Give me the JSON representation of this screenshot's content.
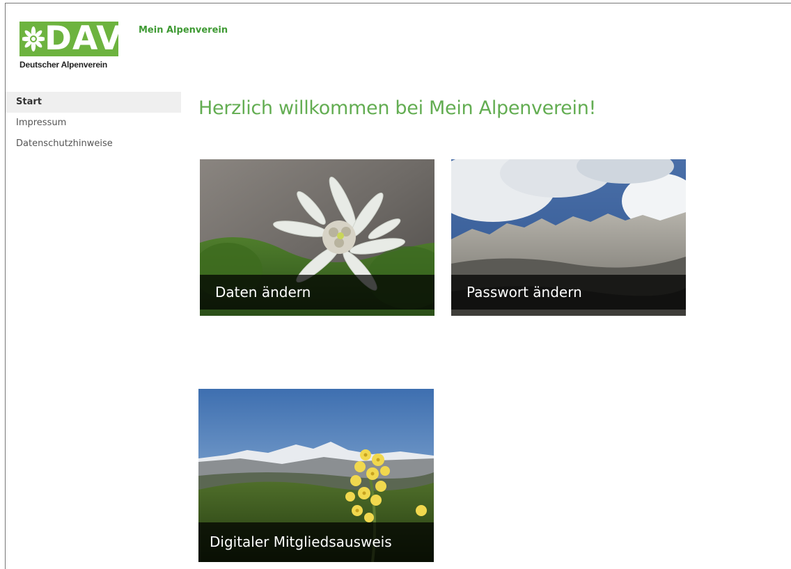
{
  "logo": {
    "letters": "DAV",
    "subtitle": "Deutscher Alpenverein",
    "icon": "edelweiss-icon",
    "brand_color": "#6db33f"
  },
  "header": {
    "app_title": "Mein Alpenverein"
  },
  "sidebar": {
    "items": [
      {
        "label": "Start",
        "active": true
      },
      {
        "label": "Impressum",
        "active": false
      },
      {
        "label": "Datenschutzhinweise",
        "active": false
      }
    ]
  },
  "main": {
    "heading": "Herzlich willkommen bei Mein Alpenverein!",
    "heading_color": "#63ad52",
    "tiles": [
      {
        "label": "Daten ändern",
        "image": "edelweiss-photo"
      },
      {
        "label": "Passwort ändern",
        "image": "mountain-ridge-photo"
      },
      {
        "label": "Digitaler Mitgliedsausweis",
        "image": "primrose-mountains-photo"
      }
    ]
  }
}
